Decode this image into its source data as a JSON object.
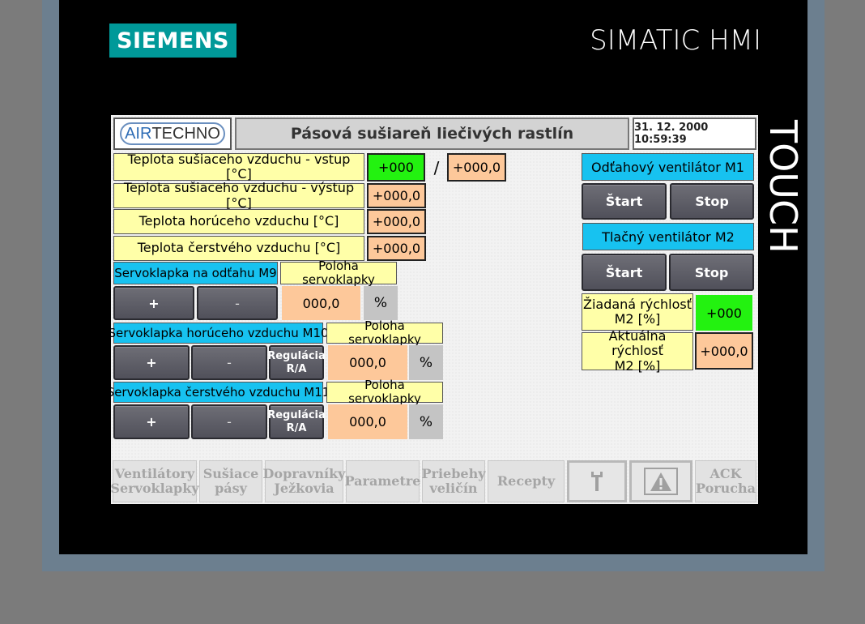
{
  "bezel": {
    "brand": "SIEMENS",
    "product": "SIMATIC HMI",
    "side_label": "TOUCH"
  },
  "header": {
    "logo_prefix": "AIR",
    "logo_suffix": "TECHNO",
    "title": "Pásová sušiareň liečivých rastlín",
    "datetime": "31. 12. 2000 10:59:39"
  },
  "temperatures": {
    "inlet_label": "Teplota sušiaceho vzduchu - vstup [°C]",
    "inlet_setpoint": "+000",
    "separator": "/",
    "inlet_actual": "+000,0",
    "outlet_label": "Teplota sušiaceho vzduchu - výstup [°C]",
    "outlet_value": "+000,0",
    "hot_label": "Teplota horúceho vzduchu [°C]",
    "hot_value": "+000,0",
    "fresh_label": "Teplota čerstvého vzduchu [°C]",
    "fresh_value": "+000,0"
  },
  "servo_m9": {
    "label": "Servoklapka na odťahu M9",
    "position_label": "Poloha servoklapky",
    "plus": "+",
    "minus": "-",
    "value": "000,0",
    "unit": "%"
  },
  "servo_m10": {
    "label": "Servoklapka horúceho vzduchu M10",
    "position_label": "Poloha servoklapky",
    "plus": "+",
    "minus": "-",
    "regulation_line1": "Regulácia",
    "regulation_line2": "R/A",
    "value": "000,0",
    "unit": "%"
  },
  "servo_m11": {
    "label": "Servoklapka čerstvého vzduchu M11",
    "position_label": "Poloha servoklapky",
    "plus": "+",
    "minus": "-",
    "regulation_line1": "Regulácia",
    "regulation_line2": "R/A",
    "value": "000,0",
    "unit": "%"
  },
  "fans": {
    "m1_label": "Odťahový ventilátor M1",
    "m1_start": "Štart",
    "m1_stop": "Stop",
    "m2_label": "Tlačný ventilátor M2",
    "m2_start": "Štart",
    "m2_stop": "Stop",
    "m2_setpoint_line1": "Žiadaná rýchlosť",
    "m2_setpoint_line2": "M2 [%]",
    "m2_setpoint_value": "+000",
    "m2_actual_line1": "Aktuálna rýchlosť",
    "m2_actual_line2": "M2 [%]",
    "m2_actual_value": "+000,0"
  },
  "function_keys": [
    {
      "line1": "Ventilátory",
      "line2": "Servoklapky"
    },
    {
      "line1": "Sušiace",
      "line2": "pásy"
    },
    {
      "line1": "Dopravníky",
      "line2": "Ježkovia"
    },
    {
      "line1": "Parametre",
      "line2": ""
    },
    {
      "line1": "Priebehy",
      "line2": "veličín"
    },
    {
      "line1": "Recepty",
      "line2": ""
    },
    {
      "icon": "wrench-icon"
    },
    {
      "icon": "warning-icon"
    },
    {
      "line1": "ACK",
      "line2": "Porucha"
    }
  ],
  "colors": {
    "siemens_teal": "#009999",
    "label_yellow": "#ffffa8",
    "label_cyan": "#17c2f0",
    "value_orange": "#fdc89a",
    "value_green": "#23f210"
  }
}
